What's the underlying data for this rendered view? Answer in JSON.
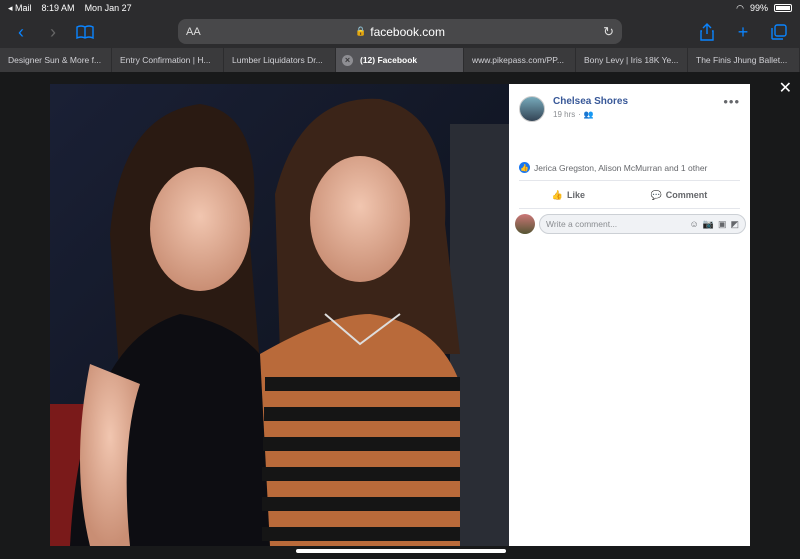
{
  "status": {
    "carrier": "◂ Mail",
    "time": "8:19 AM",
    "date": "Mon Jan 27",
    "battery": "99%"
  },
  "toolbar": {
    "url": "facebook.com",
    "aa": "AA"
  },
  "tabs": [
    {
      "label": "Designer Sun & More f..."
    },
    {
      "label": "Entry Confirmation | H..."
    },
    {
      "label": "Lumber Liquidators Dr..."
    },
    {
      "label": "(12) Facebook"
    },
    {
      "label": "www.pikepass.com/PP..."
    },
    {
      "label": "Bony Levy | Iris 18K Ye..."
    },
    {
      "label": "The Finis Jhung Ballet..."
    }
  ],
  "post": {
    "author": "Chelsea Shores",
    "time": "19 hrs",
    "reactions": "Jerica Gregston, Alison McMurran and 1 other",
    "like_label": "Like",
    "comment_label": "Comment",
    "comment_placeholder": "Write a comment..."
  },
  "colors": {
    "accent": "#0a84ff",
    "fb_blue": "#385898"
  }
}
